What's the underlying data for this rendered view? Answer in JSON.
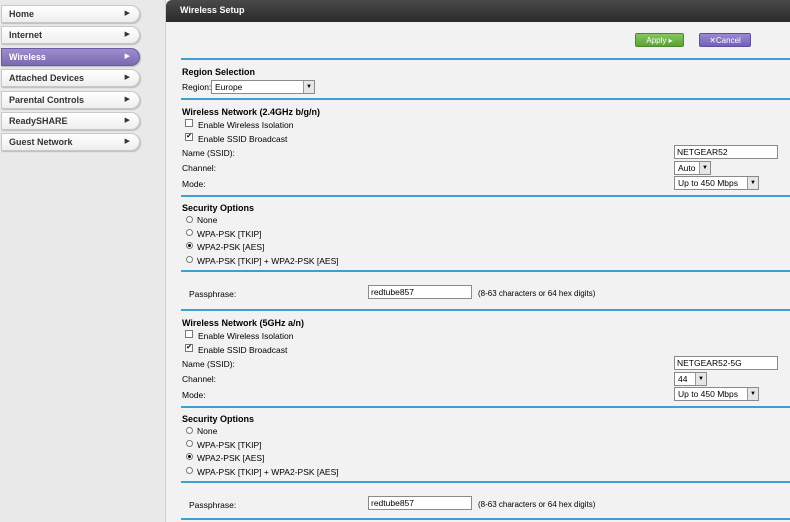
{
  "sidebar": {
    "items": [
      {
        "label": "Home"
      },
      {
        "label": "Internet"
      },
      {
        "label": "Wireless"
      },
      {
        "label": "Attached Devices"
      },
      {
        "label": "Parental Controls"
      },
      {
        "label": "ReadySHARE"
      },
      {
        "label": "Guest Network"
      }
    ],
    "active_index": 2
  },
  "header": {
    "title": "Wireless Setup"
  },
  "buttons": {
    "apply": "Apply ▸",
    "cancel": "Cancel",
    "cancel_icon": "✕"
  },
  "region": {
    "title": "Region Selection",
    "label": "Region:",
    "value": "Europe"
  },
  "network24": {
    "title": "Wireless Network (2.4GHz b/g/n)",
    "isolation_label": "Enable Wireless Isolation",
    "isolation_checked": false,
    "broadcast_label": "Enable SSID Broadcast",
    "broadcast_checked": true,
    "ssid_label": "Name (SSID):",
    "ssid_value": "NETGEAR52",
    "channel_label": "Channel:",
    "channel_value": "Auto",
    "mode_label": "Mode:",
    "mode_value": "Up to 450 Mbps"
  },
  "security24": {
    "title": "Security Options",
    "options": [
      "None",
      "WPA-PSK [TKIP]",
      "WPA2-PSK [AES]",
      "WPA-PSK [TKIP] + WPA2-PSK [AES]"
    ],
    "selected_index": 2,
    "passphrase_label": "Passphrase:",
    "passphrase_value": "redtube857",
    "passphrase_hint": "(8-63 characters or 64 hex digits)"
  },
  "network5": {
    "title": "Wireless Network (5GHz a/n)",
    "isolation_label": "Enable Wireless Isolation",
    "isolation_checked": false,
    "broadcast_label": "Enable SSID Broadcast",
    "broadcast_checked": true,
    "ssid_label": "Name (SSID):",
    "ssid_value": "NETGEAR52-5G",
    "channel_label": "Channel:",
    "channel_value": "44",
    "mode_label": "Mode:",
    "mode_value": "Up to 450 Mbps"
  },
  "security5": {
    "title": "Security Options",
    "options": [
      "None",
      "WPA-PSK [TKIP]",
      "WPA2-PSK [AES]",
      "WPA-PSK [TKIP] + WPA2-PSK [AES]"
    ],
    "selected_index": 2,
    "passphrase_label": "Passphrase:",
    "passphrase_value": "redtube857",
    "passphrase_hint": "(8-63 characters or 64 hex digits)"
  },
  "colors": {
    "accent_line": "#3f9fd2",
    "active_nav": "#7b69b3",
    "apply": "#5aa238",
    "cancel": "#7361b6"
  }
}
